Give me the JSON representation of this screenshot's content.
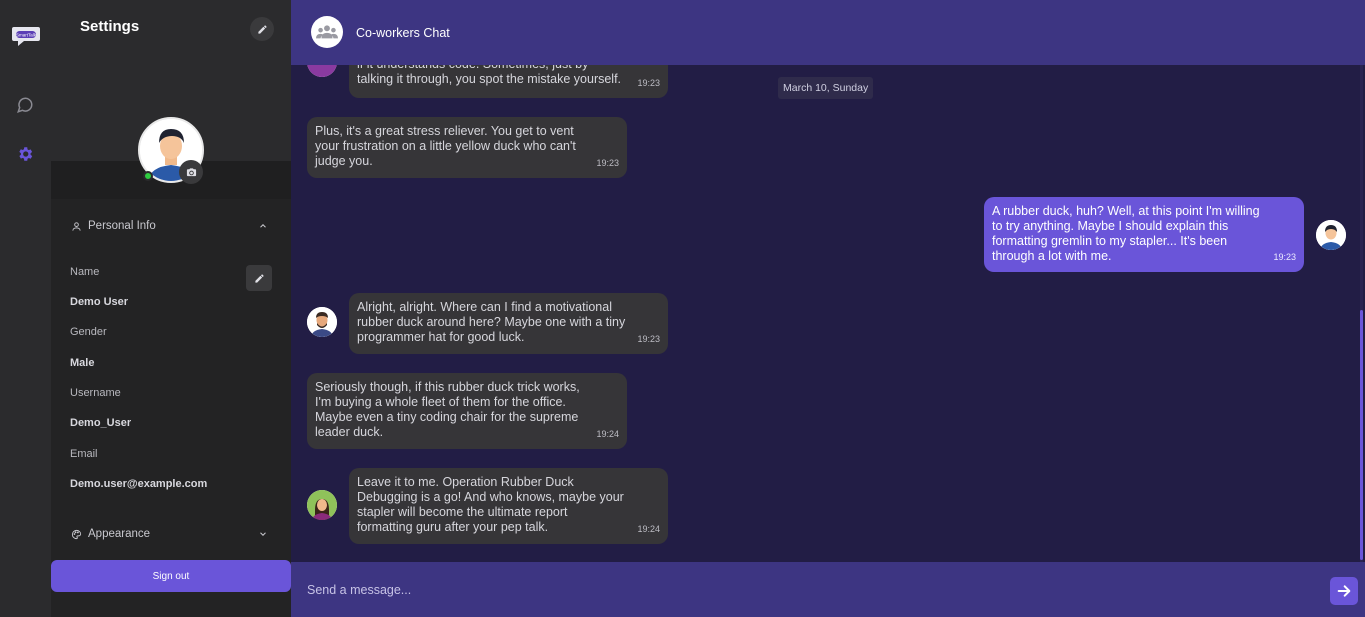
{
  "app": {
    "logo_text": "SmartTalk"
  },
  "rail": {
    "icons": [
      "chat-bubble-icon",
      "gear-icon"
    ],
    "active_color": "#6a55d9"
  },
  "settings": {
    "title": "Settings",
    "personal_info": {
      "heading": "Personal Info",
      "fields": [
        {
          "label": "Name",
          "value": "Demo User"
        },
        {
          "label": "Gender",
          "value": "Male"
        },
        {
          "label": "Username",
          "value": "Demo_User"
        },
        {
          "label": "Email",
          "value": "Demo.user@example.com"
        }
      ]
    },
    "appearance": {
      "heading": "Appearance"
    },
    "signout_label": "Sign out",
    "status": "online"
  },
  "chat": {
    "title": "Co-workers Chat",
    "date_divider": "March 10, Sunday",
    "messages": [
      {
        "text": "if it understands code. Sometimes, just by\ntalking it through, you spot the mistake yourself.",
        "time": "19:23",
        "mine": false
      },
      {
        "text": "Plus, it's a great stress reliever. You get to vent\nyour frustration on a little yellow duck who can't\njudge you.",
        "time": "19:23",
        "mine": false
      },
      {
        "text": "A rubber duck, huh? Well, at this point I'm willing\nto try anything. Maybe I should explain this\nformatting gremlin to my stapler... It's been\nthrough a lot with me.",
        "time": "19:23",
        "mine": true
      },
      {
        "text": "Alright, alright. Where can I find a motivational\nrubber duck around here? Maybe one with a tiny\nprogrammer hat for good luck.",
        "time": "19:23",
        "mine": false
      },
      {
        "text": "Seriously though, if this rubber duck trick works,\nI'm buying a whole fleet of them for the office.\nMaybe even a tiny coding chair for the supreme\nleader duck.",
        "time": "19:24",
        "mine": false
      },
      {
        "text": "Leave it to me. Operation Rubber Duck\nDebugging is a go! And who knows, maybe your\nstapler will become the ultimate report\nformatting guru after your pep talk.",
        "time": "19:24",
        "mine": false
      }
    ],
    "composer_placeholder": "Send a message..."
  },
  "colors": {
    "accent": "#6a55d9",
    "header": "#3d3582",
    "chat_bg": "#221d45",
    "bubble": "#363538",
    "online": "#2ecc40"
  }
}
